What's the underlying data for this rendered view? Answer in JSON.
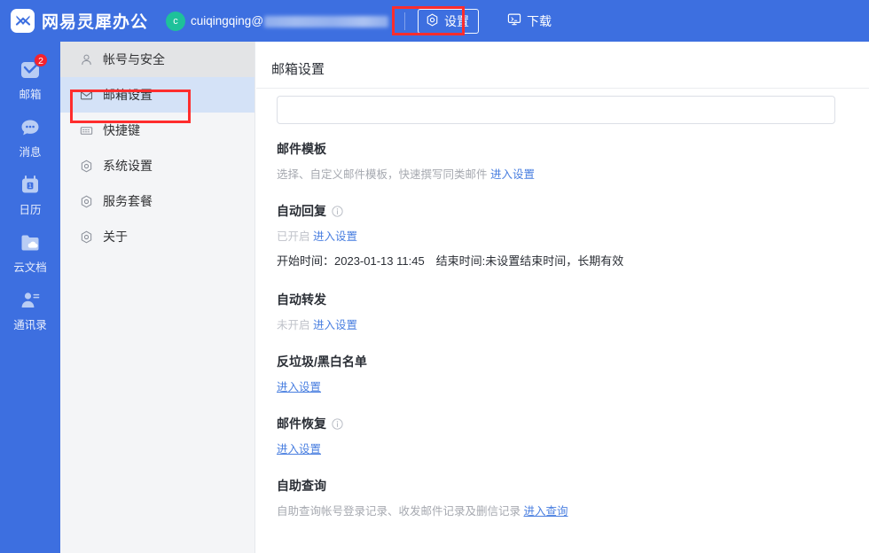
{
  "header": {
    "logo_text": "网易灵犀办公",
    "logo_icon": "netease-lingxi-logo-icon",
    "avatar_letter": "c",
    "user_email": "cuiqingqing@",
    "settings_label": "设置",
    "settings_icon": "gear-icon",
    "download_label": "下载",
    "download_icon": "monitor-download-icon"
  },
  "rail": {
    "items": [
      {
        "label": "邮箱",
        "icon": "mail-icon",
        "badge": "2"
      },
      {
        "label": "消息",
        "icon": "chat-bubble-icon",
        "badge": ""
      },
      {
        "label": "日历",
        "icon": "calendar-icon",
        "badge": "",
        "day": "1"
      },
      {
        "label": "云文档",
        "icon": "cloud-folder-icon",
        "badge": ""
      },
      {
        "label": "通讯录",
        "icon": "contacts-icon",
        "badge": ""
      }
    ]
  },
  "nav": {
    "items": [
      {
        "label": "帐号与安全",
        "icon": "user-account-icon",
        "state": "hovered"
      },
      {
        "label": "邮箱设置",
        "icon": "mail-envelope-icon",
        "state": "selected"
      },
      {
        "label": "快捷键",
        "icon": "keyboard-icon",
        "state": ""
      },
      {
        "label": "系统设置",
        "icon": "gear-icon",
        "state": ""
      },
      {
        "label": "服务套餐",
        "icon": "package-icon",
        "state": ""
      },
      {
        "label": "关于",
        "icon": "info-circle-icon",
        "state": ""
      }
    ]
  },
  "main": {
    "title": "邮箱设置",
    "input_value": "",
    "input_placeholder": "",
    "sections": [
      {
        "title": "邮件模板",
        "sub_text": "选择、自定义邮件模板，快速撰写同类邮件",
        "sub_link": "进入设置",
        "has_info": false
      },
      {
        "title": "自动回复",
        "has_info": true,
        "status": "已开启",
        "status_link": "进入设置",
        "detail": "开始时间：2023-01-13 11:45　结束时间:未设置结束时间，长期有效"
      },
      {
        "title": "自动转发",
        "has_info": false,
        "status": "未开启",
        "status_link": "进入设置"
      },
      {
        "title": "反垃圾/黑白名单",
        "has_info": false,
        "only_link": "进入设置"
      },
      {
        "title": "邮件恢复",
        "has_info": true,
        "only_link": "进入设置"
      },
      {
        "title": "自助查询",
        "has_info": false,
        "sub_text": "自助查询帐号登录记录、收发邮件记录及删信记录",
        "sub_link": "进入查询"
      }
    ]
  },
  "annotations": {
    "settings_highlight": "red-box-settings",
    "mail_settings_highlight": "red-box-mail-settings",
    "color": "#ff2d2d"
  },
  "colors": {
    "brand_blue": "#3d6fe0",
    "link_blue": "#4a7fe0",
    "selected_nav": "#d4e2f7",
    "hover_nav": "#e3e4e6",
    "badge_red": "#f5222d",
    "avatar_green": "#1ec19a"
  }
}
